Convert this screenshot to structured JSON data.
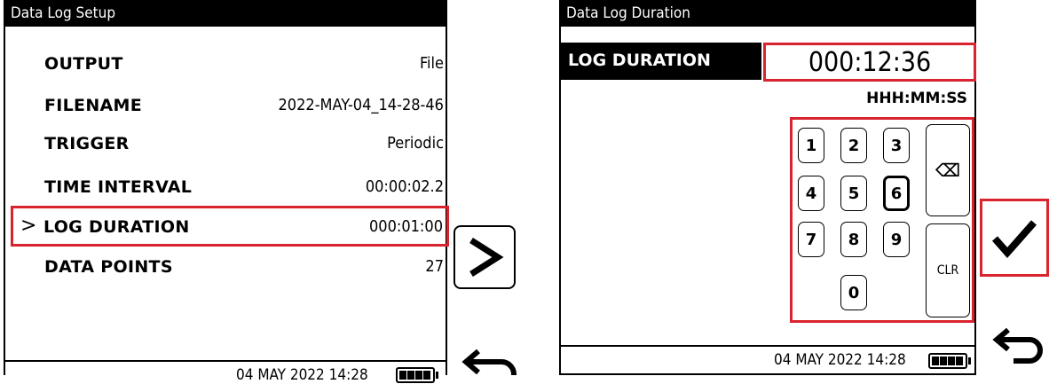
{
  "left_screen": {
    "title": "Data Log Setup",
    "rows": [
      {
        "label": "OUTPUT",
        "value": "File"
      },
      {
        "label": "FILENAME",
        "value": "2022-MAY-04_14-28-46"
      },
      {
        "label": "TRIGGER",
        "value": "Periodic"
      },
      {
        "label": "TIME INTERVAL",
        "value": "00:00:02.2"
      },
      {
        "label": "LOG DURATION",
        "value": "000:01:00",
        "selected": true
      },
      {
        "label": "DATA POINTS",
        "value": "27"
      }
    ],
    "selected_marker": ">",
    "status": "04 MAY 2022 14:28"
  },
  "right_screen": {
    "title": "Data Log Duration",
    "field_label": "LOG DURATION",
    "field_value": "000:12:36",
    "format_hint": "HHH:MM:SS",
    "keys": [
      "1",
      "2",
      "3",
      "4",
      "5",
      "6",
      "7",
      "8",
      "9",
      "0"
    ],
    "backspace_label": "⌫",
    "clear_label": "CLR",
    "active_key": "6",
    "status": "04 MAY 2022 14:28"
  },
  "arrow_button_label": ">",
  "confirm_icon": "check-icon",
  "back_icon": "return-arrow-icon",
  "colors": {
    "highlight": "#d9232e",
    "title_bg": "#000000"
  }
}
